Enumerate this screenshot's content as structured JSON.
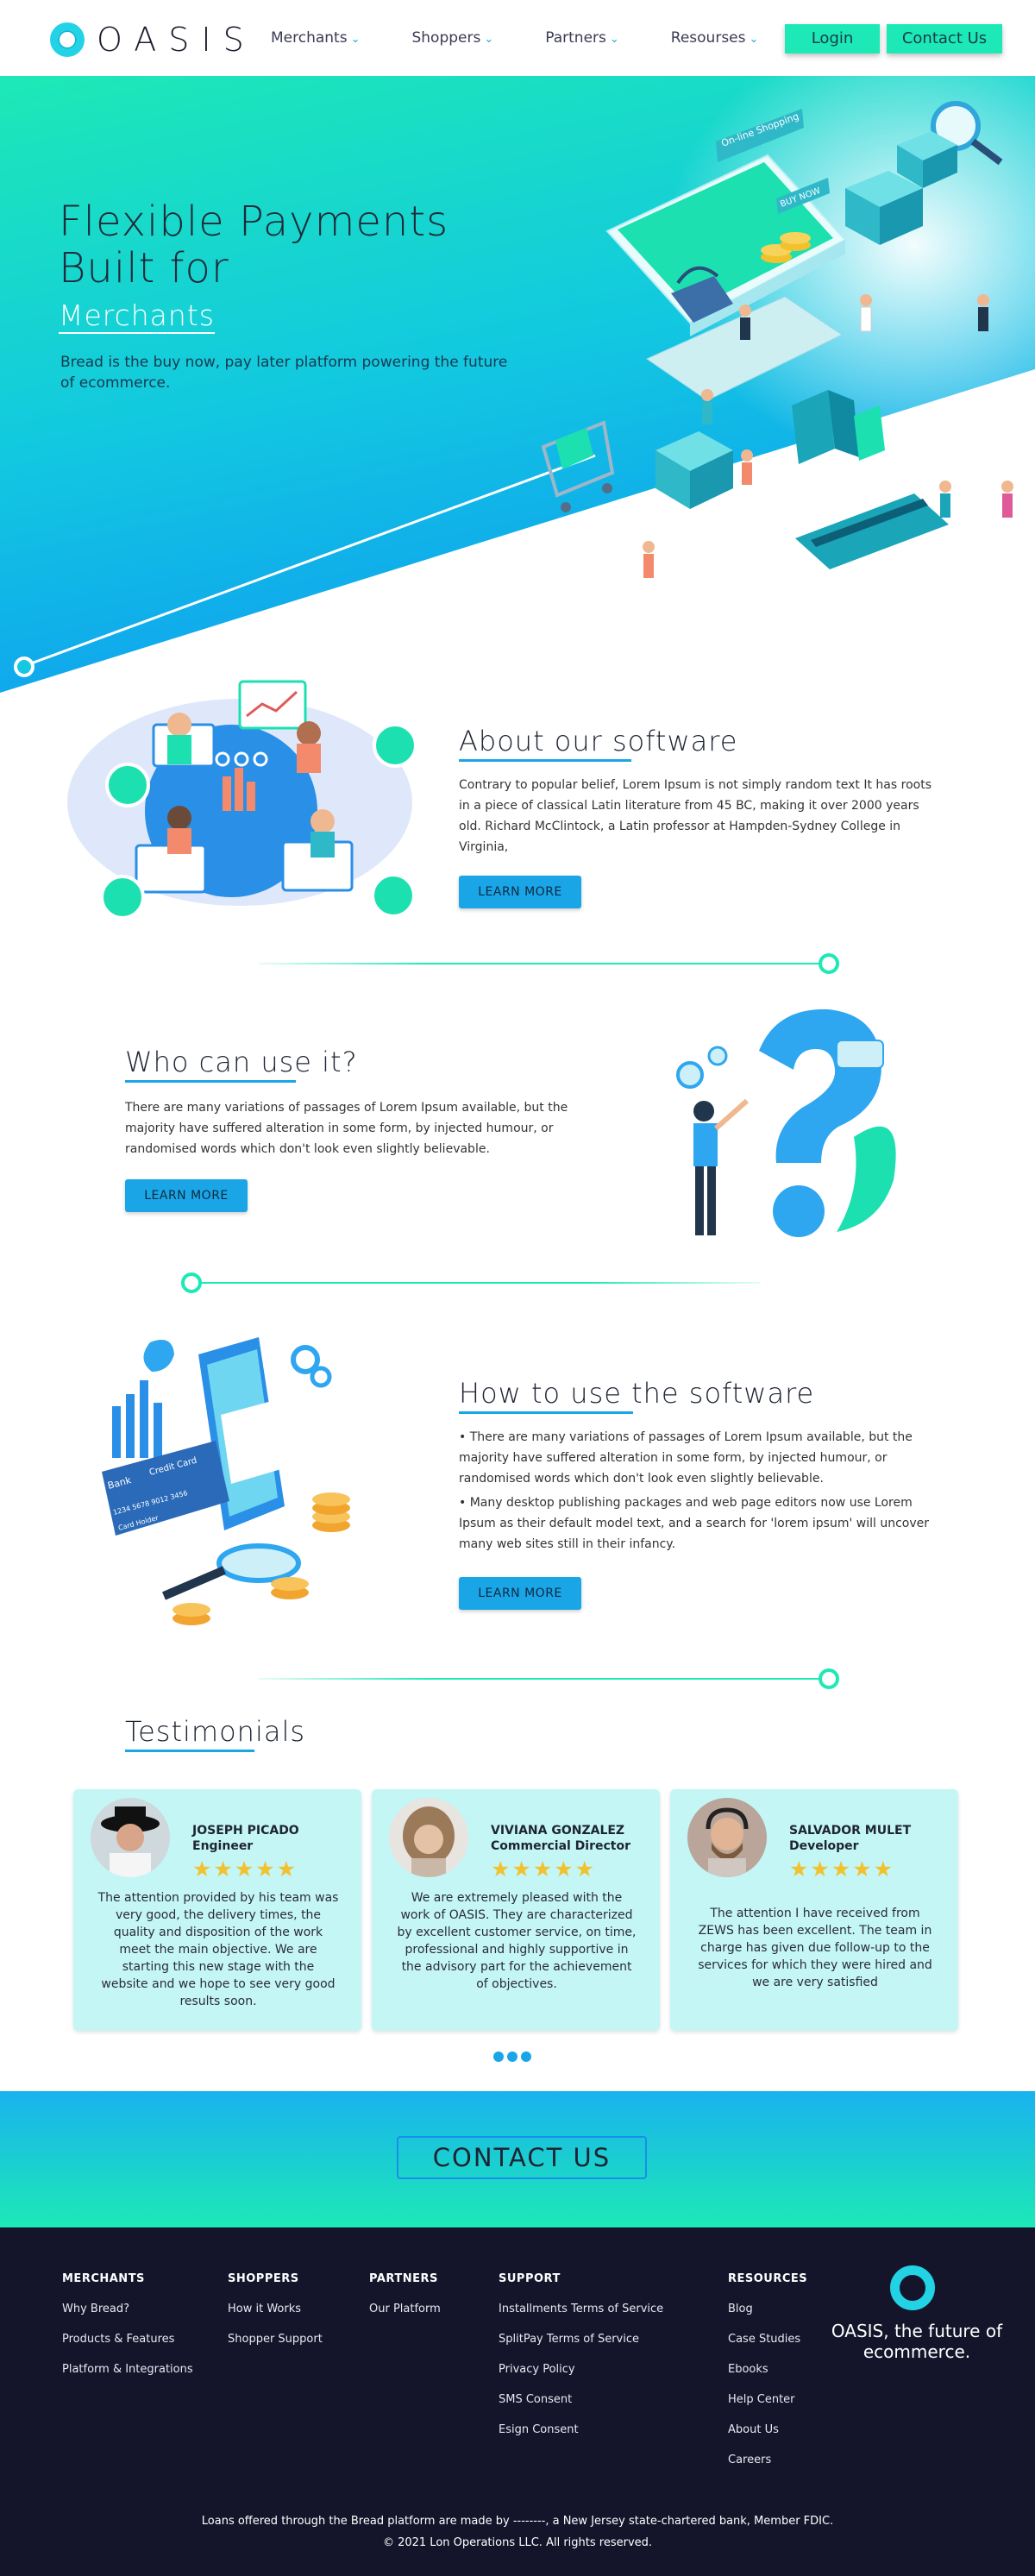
{
  "nav": {
    "brand": "OASIS",
    "items": [
      {
        "label": "Merchants"
      },
      {
        "label": "Shoppers"
      },
      {
        "label": "Partners"
      },
      {
        "label": "Resourses"
      }
    ],
    "chevron": "⌄",
    "login": "Login",
    "contact": "Contact Us"
  },
  "hero": {
    "title_line1": "Flexible Payments",
    "title_line2": "Built for",
    "subtitle": "Merchants",
    "description": "Bread is the buy now, pay later platform powering the future of ecommerce.",
    "illustration_labels": {
      "sign1": "On-line Shopping",
      "sign2": "BUY NOW"
    }
  },
  "about": {
    "title": "About our software",
    "text": "Contrary to popular belief, Lorem Ipsum is not simply random text It has roots in a piece of classical Latin literature from 45 BC, making it over 2000 years old. Richard McClintock, a Latin professor at Hampden-Sydney College in Virginia,",
    "button": "LEARN MORE"
  },
  "who": {
    "title": "Who can use it?",
    "text": "There are many variations of passages of Lorem Ipsum available, but the majority have suffered alteration in some form, by injected humour, or randomised words which don't look even slightly believable.",
    "button": "LEARN MORE"
  },
  "howto": {
    "title": "How to use the software",
    "bullet1": "• There are many variations of passages of Lorem Ipsum available, but the majority have suffered alteration in some form, by injected humour, or randomised words which don't look even slightly believable.",
    "bullet2": "• Many desktop publishing packages and web page editors now use Lorem Ipsum as their default model text, and a search for 'lorem ipsum' will uncover many web sites still in their infancy.",
    "button": "LEARN MORE",
    "card_labels": {
      "bank": "Bank",
      "credit": "Credit Card",
      "number": "1234 5678 9012 3456",
      "holder": "Card Holder"
    }
  },
  "testimonials": {
    "title": "Testimonials",
    "stars": "★★★★★",
    "items": [
      {
        "name": "JOSEPH PICADO",
        "role": "Engineer",
        "text": "The attention provided by his team was very good, the delivery times, the quality and disposition of the work meet the main objective. We are starting this new stage with the website and we hope to see very good results soon."
      },
      {
        "name": "VIVIANA GONZALEZ",
        "role": "Commercial Director",
        "text": "We are extremely pleased with the work of OASIS. They are characterized by excellent customer service, on time, professional and highly supportive in the advisory part for the achievement of objectives."
      },
      {
        "name": "SALVADOR MULET",
        "role": "Developer",
        "text": "The attention I have received from ZEWS has been excellent. The team in charge has given due follow-up to the services for which they were hired and we are very satisfied"
      }
    ]
  },
  "contact_band": {
    "button": "CONTACT US"
  },
  "footer": {
    "columns": [
      {
        "head": "MERCHANTS",
        "links": [
          "Why Bread?",
          "Products & Features",
          "Platform & Integrations"
        ]
      },
      {
        "head": "SHOPPERS",
        "links": [
          "How it Works",
          "Shopper Support"
        ]
      },
      {
        "head": "PARTNERS",
        "links": [
          "Our Platform"
        ]
      },
      {
        "head": "SUPPORT",
        "links": [
          "Installments Terms of Service",
          "SplitPay Terms of Service",
          "Privacy Policy",
          "SMS Consent",
          "Esign Consent"
        ]
      },
      {
        "head": "RESOURCES",
        "links": [
          "Blog",
          "Case Studies",
          "Ebooks",
          "Help Center",
          "About Us",
          "Careers"
        ]
      }
    ],
    "tagline": "OASIS, the future of ecommerce.",
    "legal1": "Loans offered through the Bread platform are made by --------, a New Jersey state-chartered bank, Member FDIC.",
    "legal2": "© 2021 Lon Operations LLC. All rights reserved."
  },
  "colors": {
    "accent": "#1de9b6",
    "blue": "#1aa6e6",
    "footer": "#14152b",
    "card": "#c4f6f5"
  }
}
